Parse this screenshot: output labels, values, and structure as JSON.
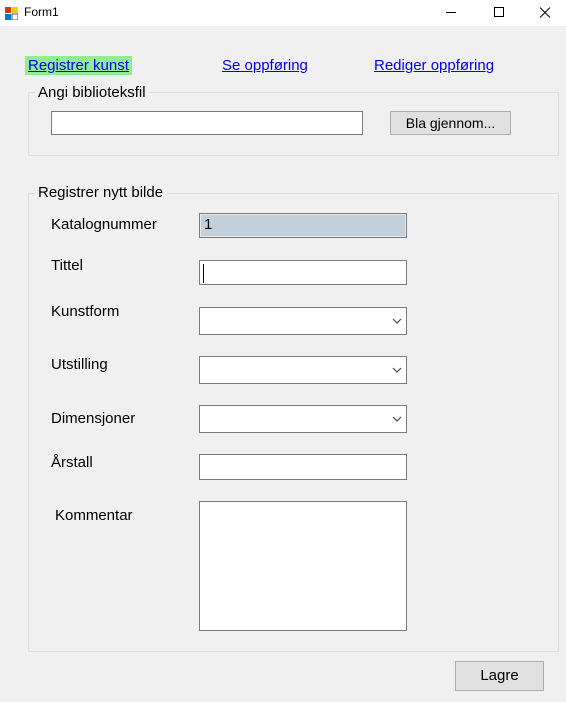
{
  "window": {
    "title": "Form1"
  },
  "nav": {
    "register": "Registrer kunst",
    "view": "Se oppføring",
    "edit": "Rediger oppføring"
  },
  "library": {
    "group_title": "Angi biblioteksfil",
    "path_value": "",
    "browse_label": "Bla gjennom..."
  },
  "register": {
    "group_title": "Registrer nytt bilde",
    "catalog_label": "Katalognummer",
    "catalog_value": "1",
    "title_label": "Tittel",
    "title_value": "",
    "artform_label": "Kunstform",
    "artform_value": "",
    "exhibition_label": "Utstilling",
    "exhibition_value": "",
    "dimensions_label": "Dimensjoner",
    "dimensions_value": "",
    "year_label": "Årstall",
    "year_value": "",
    "comment_label": "Kommentar",
    "comment_value": ""
  },
  "actions": {
    "save_label": "Lagre"
  },
  "colors": {
    "active_link_bg": "#90ee90",
    "link": "#0000ee",
    "readonly_bg": "#c2d0dc",
    "form_bg": "#f0f0f0"
  }
}
